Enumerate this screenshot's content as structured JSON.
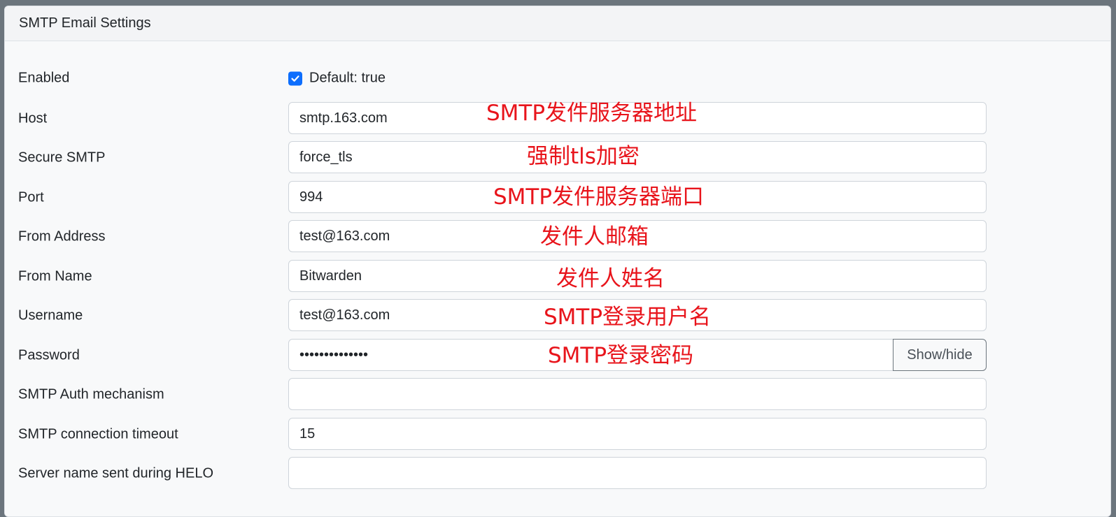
{
  "panel": {
    "title": "SMTP Email Settings"
  },
  "fields": {
    "enabled": {
      "label": "Enabled",
      "checked": true,
      "hint": "Default: true"
    },
    "host": {
      "label": "Host",
      "value": "smtp.163.com"
    },
    "secure": {
      "label": "Secure SMTP",
      "value": "force_tls"
    },
    "port": {
      "label": "Port",
      "value": "994"
    },
    "from_address": {
      "label": "From Address",
      "value": "test@163.com"
    },
    "from_name": {
      "label": "From Name",
      "value": "Bitwarden"
    },
    "username": {
      "label": "Username",
      "value": "test@163.com"
    },
    "password": {
      "label": "Password",
      "value": "••••••••••••••",
      "toggle_label": "Show/hide"
    },
    "auth_mechanism": {
      "label": "SMTP Auth mechanism",
      "value": ""
    },
    "timeout": {
      "label": "SMTP connection timeout",
      "value": "15"
    },
    "helo_name": {
      "label": "Server name sent during HELO",
      "value": ""
    }
  },
  "annotations": {
    "host": "SMTP发件服务器地址",
    "secure": "强制tls加密",
    "port": "SMTP发件服务器端口",
    "from_address": "发件人邮箱",
    "from_name": "发件人姓名",
    "username": "SMTP登录用户名",
    "password": "SMTP登录密码"
  },
  "colors": {
    "accent": "#0d6efd",
    "annotation": "#e8141b"
  },
  "icons": {
    "checkbox": "check-icon"
  }
}
